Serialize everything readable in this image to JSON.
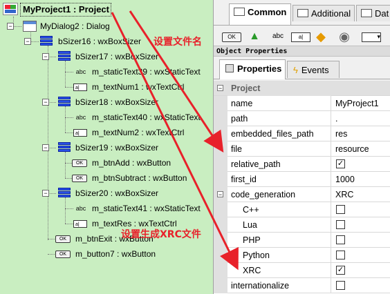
{
  "tree": {
    "root": "MyProject1 : Project",
    "root_icon": "wxfb-project-icon",
    "nodes": [
      {
        "label": "MyDialog2 : Dialog",
        "icon": "dialog-icon"
      },
      {
        "label": "bSizer16 : wxBoxSizer",
        "icon": "boxsizer-icon"
      },
      {
        "label": "bSizer17 : wxBoxSizer",
        "icon": "boxsizer-icon"
      },
      {
        "label": "m_staticText39 : wxStaticText",
        "icon": "statictext-icon",
        "icon_text": "abc"
      },
      {
        "label": "m_textNum1 : wxTextCtrl",
        "icon": "textctrl-icon",
        "icon_text": "a|"
      },
      {
        "label": "bSizer18 : wxBoxSizer",
        "icon": "boxsizer-icon"
      },
      {
        "label": "m_staticText40 : wxStaticText",
        "icon": "statictext-icon",
        "icon_text": "abc"
      },
      {
        "label": "m_textNum2 : wxTextCtrl",
        "icon": "textctrl-icon",
        "icon_text": "a|"
      },
      {
        "label": "bSizer19 : wxBoxSizer",
        "icon": "boxsizer-icon"
      },
      {
        "label": "m_btnAdd : wxButton",
        "icon": "button-icon",
        "icon_text": "OK"
      },
      {
        "label": "m_btnSubtract : wxButton",
        "icon": "button-icon",
        "icon_text": "OK"
      },
      {
        "label": "bSizer20 : wxBoxSizer",
        "icon": "boxsizer-icon"
      },
      {
        "label": "m_staticText41 : wxStaticText",
        "icon": "statictext-icon",
        "icon_text": "abc"
      },
      {
        "label": "m_textRes : wxTextCtrl",
        "icon": "textctrl-icon",
        "icon_text": "a|"
      },
      {
        "label": "m_btnExit : wxButton",
        "icon": "button-icon",
        "icon_text": "OK"
      },
      {
        "label": "m_button7 : wxButton",
        "icon": "button-icon",
        "icon_text": "OK"
      }
    ],
    "expander_symbol": "−"
  },
  "palette": {
    "tabs": [
      "Common",
      "Additional",
      "Dat"
    ],
    "tools": [
      {
        "name": "button-tool-icon",
        "text": "OK"
      },
      {
        "name": "bitmap-tool-icon",
        "text": "▲"
      },
      {
        "name": "statictext-tool-icon",
        "text": "abc"
      },
      {
        "name": "textctrl-tool-icon",
        "text": "a|"
      },
      {
        "name": "shapes-tool-icon",
        "text": "◆"
      },
      {
        "name": "animation-tool-icon",
        "text": "◉"
      },
      {
        "name": "combobox-tool-icon",
        "text": "▾"
      }
    ]
  },
  "object_properties": {
    "header": "Object Properties",
    "tabs": [
      "Properties",
      "Events"
    ],
    "category": "Project",
    "rows": [
      {
        "name": "name",
        "value": "MyProject1"
      },
      {
        "name": "path",
        "value": "."
      },
      {
        "name": "embedded_files_path",
        "value": "res"
      },
      {
        "name": "file",
        "value": "resource"
      },
      {
        "name": "relative_path",
        "checkbox": true,
        "checked": true
      },
      {
        "name": "first_id",
        "value": "1000"
      },
      {
        "name": "code_generation",
        "value": "XRC",
        "expandable": true
      },
      {
        "name": "C++",
        "checkbox": true,
        "checked": false,
        "indent": true
      },
      {
        "name": "Lua",
        "checkbox": true,
        "checked": false,
        "indent": true
      },
      {
        "name": "PHP",
        "checkbox": true,
        "checked": false,
        "indent": true
      },
      {
        "name": "Python",
        "checkbox": true,
        "checked": false,
        "indent": true
      },
      {
        "name": "XRC",
        "checkbox": true,
        "checked": true,
        "indent": true
      },
      {
        "name": "internationalize",
        "checkbox": true,
        "checked": false
      }
    ],
    "check_mark": "✓",
    "collapse_symbol": "−"
  },
  "annotations": {
    "set_filename": "设置文件名",
    "set_xrc": "设置生成XRC文件",
    "color": "#e8212a"
  },
  "colors": {
    "tree_bg": "#c9eec1",
    "sizer_blue": "#2a52e8",
    "panel_bg": "#f0f0f0"
  }
}
